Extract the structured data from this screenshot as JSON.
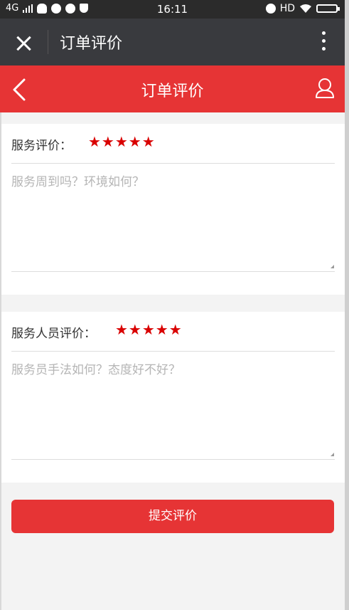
{
  "status_bar": {
    "network": "4G",
    "time": "16:11",
    "hd": "HD"
  },
  "wechat_bar": {
    "title": "订单评价"
  },
  "header": {
    "title": "订单评价"
  },
  "service_rating": {
    "label": "服务评价：",
    "stars": "★★★★★",
    "rating": 5,
    "placeholder": "服务周到吗？环境如何？"
  },
  "staff_rating": {
    "label": "服务人员评价：",
    "stars": "★★★★★",
    "rating": 5,
    "placeholder": "服务员手法如何？态度好不好？"
  },
  "submit": {
    "label": "提交评价"
  },
  "colors": {
    "accent": "#e63435",
    "star": "#d90000",
    "wechat_bar": "#393a3e"
  }
}
